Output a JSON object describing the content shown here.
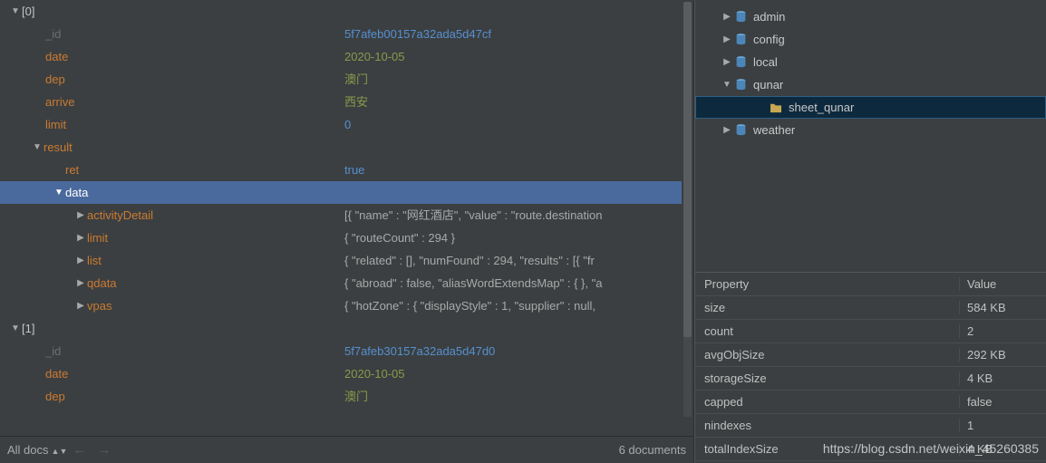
{
  "doc_tree": {
    "root0": "[0]",
    "fields0": [
      {
        "key": "_id",
        "val": "5f7afeb00157a32ada5d47cf",
        "kcls": "key-dim",
        "vcls": "val-blue",
        "indent": 50
      },
      {
        "key": "date",
        "val": "2020-10-05",
        "kcls": "key-orange",
        "vcls": "val-olive",
        "indent": 50
      },
      {
        "key": "dep",
        "val": "澳门",
        "kcls": "key-orange",
        "vcls": "val-olive",
        "indent": 50
      },
      {
        "key": "arrive",
        "val": "西安",
        "kcls": "key-orange",
        "vcls": "val-olive",
        "indent": 50
      },
      {
        "key": "limit",
        "val": "0",
        "kcls": "key-orange",
        "vcls": "val-blue",
        "indent": 50
      }
    ],
    "result_key": "result",
    "ret_key": "ret",
    "ret_val": "true",
    "data_key": "data",
    "data_children": [
      {
        "key": "activityDetail",
        "val": "[{ \"name\" : \"网红酒店\", \"value\" : \"route.destination"
      },
      {
        "key": "limit",
        "val": "{ \"routeCount\" : 294 }"
      },
      {
        "key": "list",
        "val": "{ \"related\" : [], \"numFound\" : 294, \"results\" : [{ \"fr"
      },
      {
        "key": "qdata",
        "val": "{ \"abroad\" : false, \"aliasWordExtendsMap\" : { }, \"a"
      },
      {
        "key": "vpas",
        "val": "{ \"hotZone\" : { \"displayStyle\" : 1, \"supplier\" : null,"
      }
    ],
    "root1": "[1]",
    "fields1": [
      {
        "key": "_id",
        "val": "5f7afeb30157a32ada5d47d0",
        "kcls": "key-dim",
        "vcls": "val-blue",
        "indent": 50
      },
      {
        "key": "date",
        "val": "2020-10-05",
        "kcls": "key-orange",
        "vcls": "val-olive",
        "indent": 50
      },
      {
        "key": "dep",
        "val": "澳门",
        "kcls": "key-orange",
        "vcls": "val-olive",
        "indent": 50
      }
    ]
  },
  "bottom": {
    "alldocs": "All docs",
    "count": "6 documents"
  },
  "db_tree": [
    {
      "name": "admin",
      "type": "db",
      "exp": "▶",
      "indent": 28,
      "sel": false
    },
    {
      "name": "config",
      "type": "db",
      "exp": "▶",
      "indent": 28,
      "sel": false
    },
    {
      "name": "local",
      "type": "db",
      "exp": "▶",
      "indent": 28,
      "sel": false
    },
    {
      "name": "qunar",
      "type": "db",
      "exp": "▼",
      "indent": 28,
      "sel": false
    },
    {
      "name": "sheet_qunar",
      "type": "coll",
      "exp": "",
      "indent": 66,
      "sel": true
    },
    {
      "name": "weather",
      "type": "db",
      "exp": "▶",
      "indent": 28,
      "sel": false
    }
  ],
  "prop_header": {
    "c1": "Property",
    "c2": "Value"
  },
  "props": [
    {
      "p": "size",
      "v": "584 KB"
    },
    {
      "p": "count",
      "v": "2"
    },
    {
      "p": "avgObjSize",
      "v": "292 KB"
    },
    {
      "p": "storageSize",
      "v": "4 KB"
    },
    {
      "p": "capped",
      "v": "false"
    },
    {
      "p": "nindexes",
      "v": "1"
    },
    {
      "p": "totalIndexSize",
      "v": "4 KB"
    }
  ],
  "watermark": "https://blog.csdn.net/weixin_45260385"
}
